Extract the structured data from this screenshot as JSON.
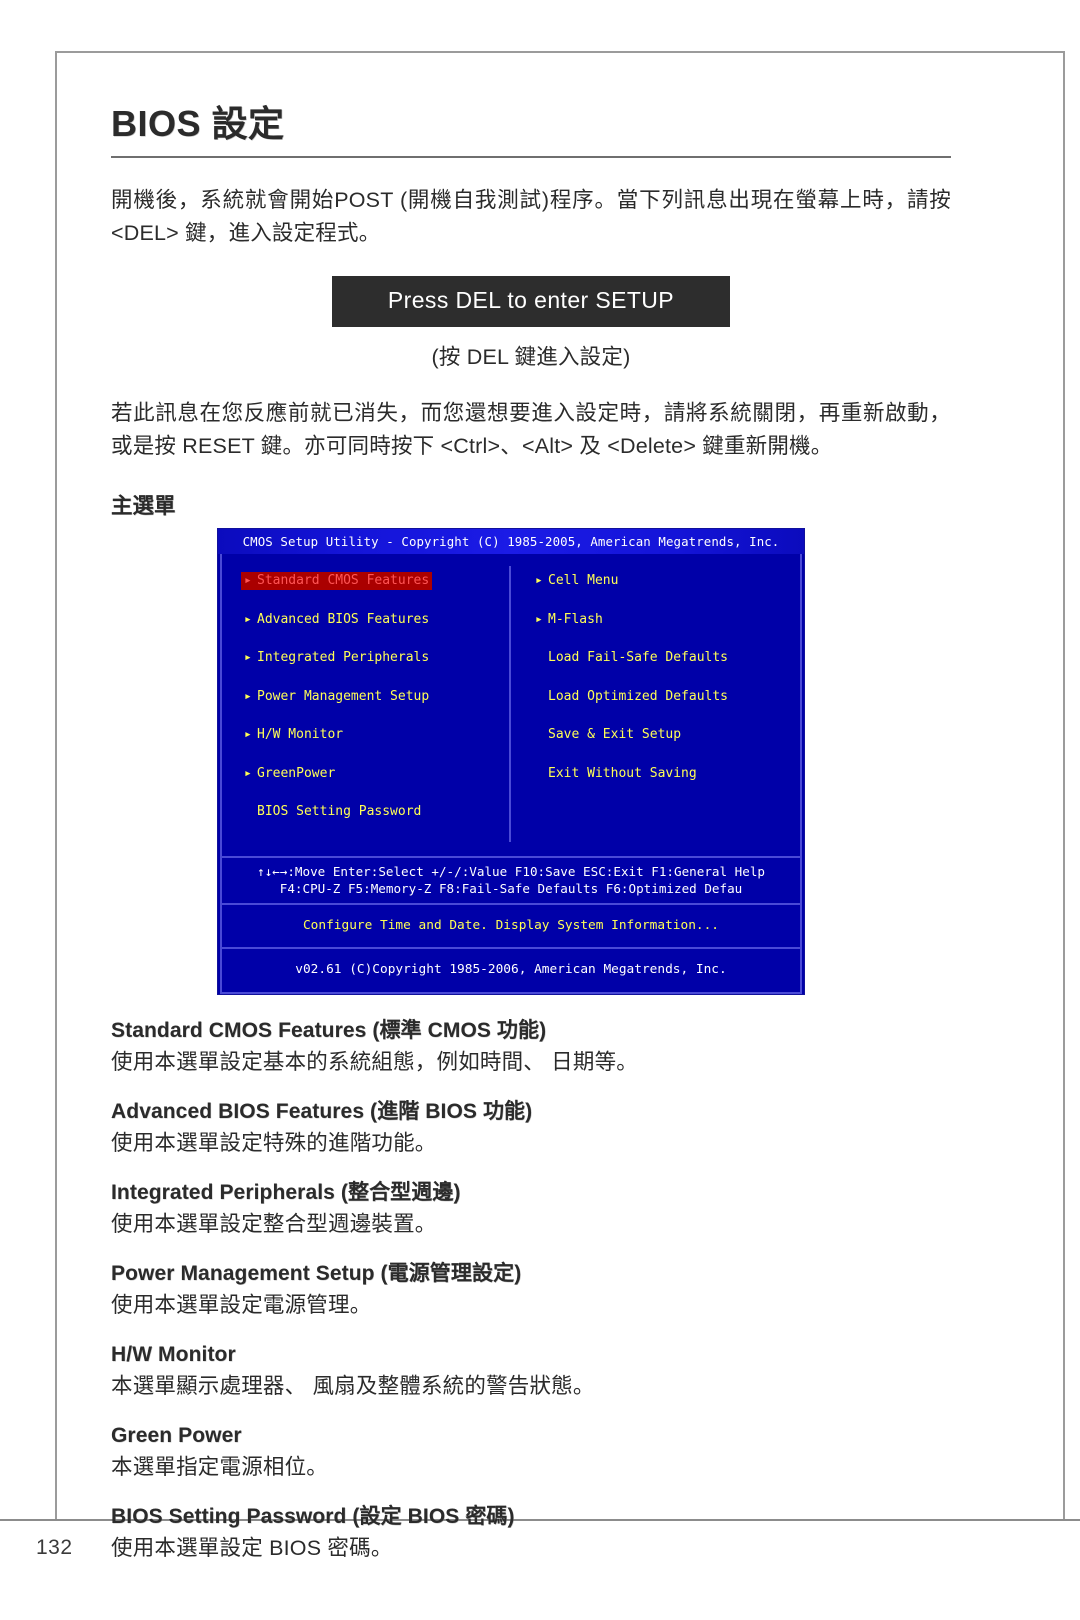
{
  "page": {
    "number": "132",
    "title": "BIOS 設定"
  },
  "intro": {
    "paragraph1": "開機後，系統就會開始POST (開機自我測試)程序。當下列訊息出現在螢幕上時，請按 <DEL> 鍵，進入設定程式。",
    "post_banner": "Press DEL to enter SETUP",
    "post_caption": "(按 DEL 鍵進入設定)",
    "paragraph2": "若此訊息在您反應前就已消失，而您還想要進入設定時，請將系統關閉，再重新啟動，或是按 RESET 鍵。亦可同時按下 <Ctrl>、<Alt> 及 <Delete> 鍵重新開機。",
    "section_heading": "主選單"
  },
  "bios": {
    "titlebar": "CMOS Setup Utility - Copyright (C) 1985-2005, American Megatrends, Inc.",
    "left_items": [
      {
        "label": "Standard CMOS Features",
        "arrow": true,
        "selected": true
      },
      {
        "label": "Advanced BIOS Features",
        "arrow": true,
        "selected": false
      },
      {
        "label": "Integrated Peripherals",
        "arrow": true,
        "selected": false
      },
      {
        "label": "Power Management Setup",
        "arrow": true,
        "selected": false
      },
      {
        "label": "H/W Monitor",
        "arrow": true,
        "selected": false
      },
      {
        "label": "GreenPower",
        "arrow": true,
        "selected": false
      },
      {
        "label": "BIOS Setting Password",
        "arrow": false,
        "selected": false
      }
    ],
    "right_items": [
      {
        "label": "Cell Menu",
        "arrow": true,
        "selected": false
      },
      {
        "label": "M-Flash",
        "arrow": true,
        "selected": false
      },
      {
        "label": "Load Fail-Safe Defaults",
        "arrow": false,
        "selected": false
      },
      {
        "label": "Load Optimized Defaults",
        "arrow": false,
        "selected": false
      },
      {
        "label": "Save & Exit Setup",
        "arrow": false,
        "selected": false
      },
      {
        "label": "Exit Without Saving",
        "arrow": false,
        "selected": false
      }
    ],
    "help_line1": "↑↓←→:Move  Enter:Select  +/-/:Value  F10:Save  ESC:Exit  F1:General Help",
    "help_line2": "F4:CPU-Z    F5:Memory-Z    F8:Fail-Safe Defaults    F6:Optimized Defau",
    "hint": "Configure Time and Date.  Display System Information...",
    "version": "v02.61 (C)Copyright 1985-2006, American Megatrends, Inc.",
    "colors": {
      "background": "#0000a8",
      "item_text": "#ffff55",
      "selected_bg": "#aa0000",
      "selected_text": "#ff5555",
      "titlebar_text": "#ffffff",
      "border": "#4a4ad6"
    }
  },
  "descriptions": [
    {
      "term": "Standard CMOS Features (標準 CMOS 功能)",
      "definition": "使用本選單設定基本的系統組態，例如時間、 日期等。"
    },
    {
      "term": "Advanced BIOS Features (進階 BIOS 功能)",
      "definition": "使用本選單設定特殊的進階功能。"
    },
    {
      "term": "Integrated Peripherals (整合型週邊)",
      "definition": "使用本選單設定整合型週邊裝置。"
    },
    {
      "term": "Power Management Setup (電源管理設定)",
      "definition": "使用本選單設定電源管理。"
    },
    {
      "term": "H/W Monitor",
      "definition": "本選單顯示處理器、 風扇及整體系統的警告狀態。"
    },
    {
      "term": "Green Power",
      "definition": "本選單指定電源相位。"
    },
    {
      "term": "BIOS Setting Password (設定 BIOS 密碼)",
      "definition": "使用本選單設定 BIOS 密碼。"
    }
  ]
}
